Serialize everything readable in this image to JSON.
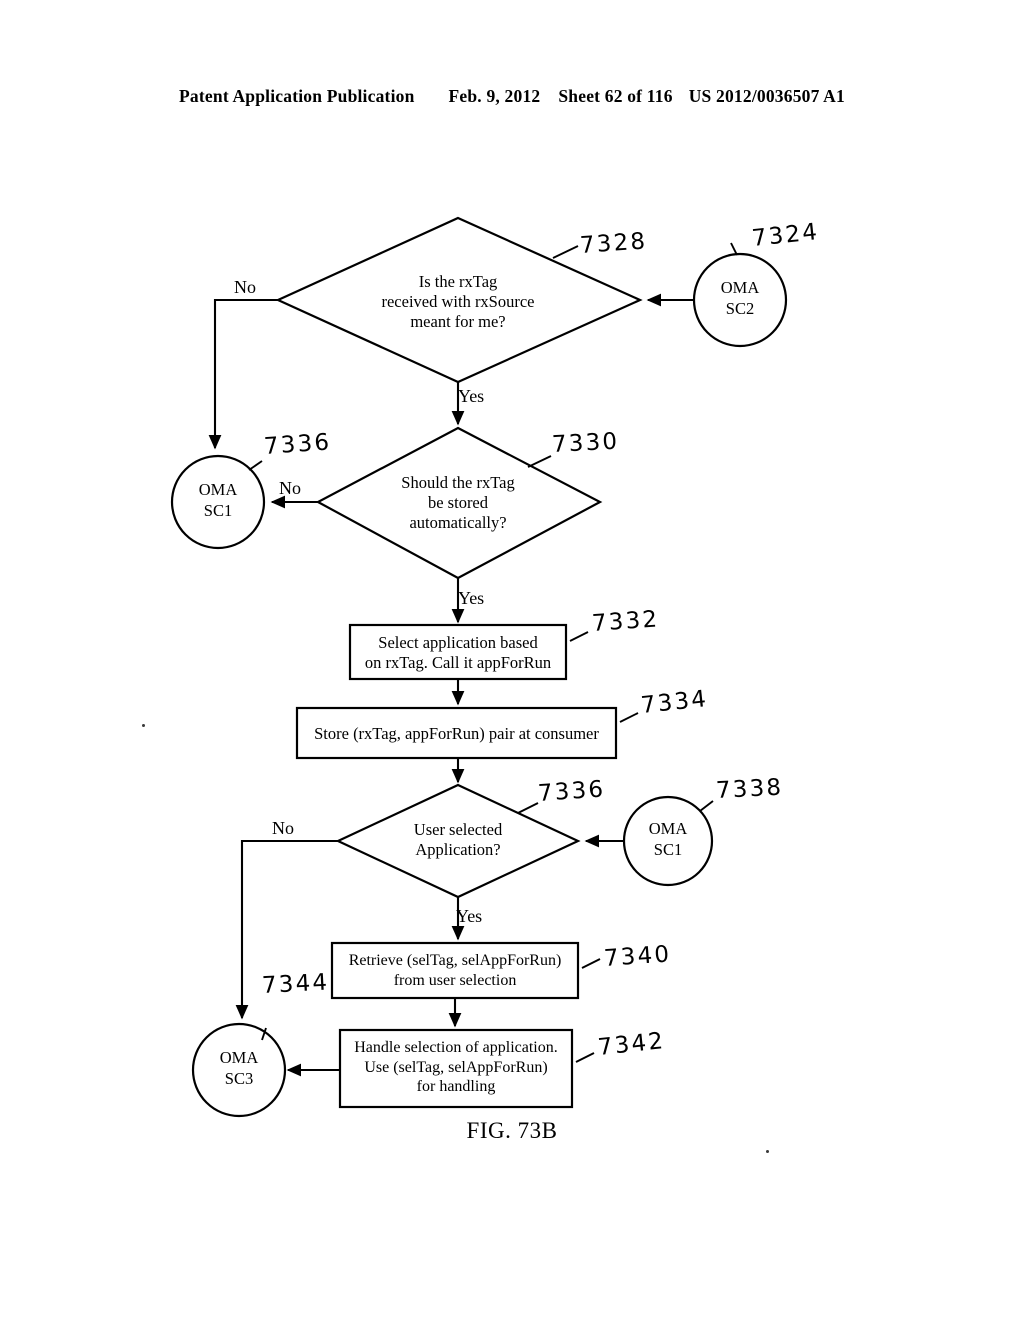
{
  "header": {
    "publication": "Patent Application Publication",
    "date": "Feb. 9, 2012",
    "sheet": "Sheet 62 of 116",
    "patent_number": "US 2012/0036507 A1"
  },
  "figure": {
    "caption": "FIG. 73B",
    "nodes": {
      "decision_rxtag_for_me": "Is the rxTag\nreceived with rxSource\nmeant for me?",
      "decision_store_auto": "Should the rxTag\nbe stored\nautomatically?",
      "process_select_app": "Select application based\non rxTag. Call it appForRun",
      "process_store_pair": "Store (rxTag, appForRun) pair at consumer",
      "decision_user_selected": "User selected\nApplication?",
      "process_retrieve": "Retrieve (selTag, selAppForRun)\nfrom user selection",
      "process_handle": "Handle selection of application.\nUse (selTag, selAppForRun)\nfor handling",
      "connector_oma_sc2": "OMA\nSC2",
      "connector_oma_sc1_left": "OMA\nSC1",
      "connector_oma_sc1_right": "OMA\nSC1",
      "connector_oma_sc3": "OMA\nSC3"
    },
    "edge_labels": {
      "no_from_rxtag_for_me": "No",
      "yes_from_rxtag_for_me": "Yes",
      "no_from_store_auto": "No",
      "yes_from_store_auto": "Yes",
      "no_from_user_selected": "No",
      "yes_from_user_selected": "Yes"
    },
    "reference_numerals": {
      "decision_rxtag_for_me": "7328",
      "connector_oma_sc2": "7324",
      "connector_oma_sc1_left": "7336",
      "decision_store_auto": "7330",
      "process_select_app": "7332",
      "process_store_pair": "7334",
      "decision_user_selected": "7336",
      "connector_oma_sc1_right": "7338",
      "process_retrieve": "7340",
      "process_handle": "7342",
      "connector_oma_sc3": "7344"
    }
  }
}
